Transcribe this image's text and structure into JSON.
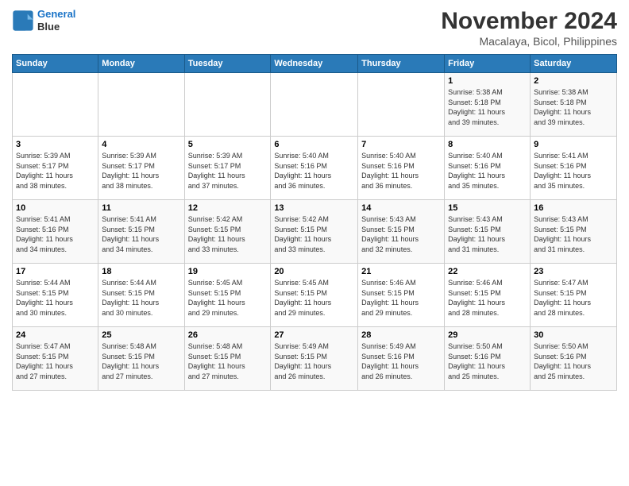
{
  "header": {
    "logo_line1": "General",
    "logo_line2": "Blue",
    "month": "November 2024",
    "location": "Macalaya, Bicol, Philippines"
  },
  "days_of_week": [
    "Sunday",
    "Monday",
    "Tuesday",
    "Wednesday",
    "Thursday",
    "Friday",
    "Saturday"
  ],
  "weeks": [
    {
      "days": [
        {
          "num": "",
          "detail": ""
        },
        {
          "num": "",
          "detail": ""
        },
        {
          "num": "",
          "detail": ""
        },
        {
          "num": "",
          "detail": ""
        },
        {
          "num": "",
          "detail": ""
        },
        {
          "num": "1",
          "detail": "Sunrise: 5:38 AM\nSunset: 5:18 PM\nDaylight: 11 hours\nand 39 minutes."
        },
        {
          "num": "2",
          "detail": "Sunrise: 5:38 AM\nSunset: 5:18 PM\nDaylight: 11 hours\nand 39 minutes."
        }
      ]
    },
    {
      "days": [
        {
          "num": "3",
          "detail": "Sunrise: 5:39 AM\nSunset: 5:17 PM\nDaylight: 11 hours\nand 38 minutes."
        },
        {
          "num": "4",
          "detail": "Sunrise: 5:39 AM\nSunset: 5:17 PM\nDaylight: 11 hours\nand 38 minutes."
        },
        {
          "num": "5",
          "detail": "Sunrise: 5:39 AM\nSunset: 5:17 PM\nDaylight: 11 hours\nand 37 minutes."
        },
        {
          "num": "6",
          "detail": "Sunrise: 5:40 AM\nSunset: 5:16 PM\nDaylight: 11 hours\nand 36 minutes."
        },
        {
          "num": "7",
          "detail": "Sunrise: 5:40 AM\nSunset: 5:16 PM\nDaylight: 11 hours\nand 36 minutes."
        },
        {
          "num": "8",
          "detail": "Sunrise: 5:40 AM\nSunset: 5:16 PM\nDaylight: 11 hours\nand 35 minutes."
        },
        {
          "num": "9",
          "detail": "Sunrise: 5:41 AM\nSunset: 5:16 PM\nDaylight: 11 hours\nand 35 minutes."
        }
      ]
    },
    {
      "days": [
        {
          "num": "10",
          "detail": "Sunrise: 5:41 AM\nSunset: 5:16 PM\nDaylight: 11 hours\nand 34 minutes."
        },
        {
          "num": "11",
          "detail": "Sunrise: 5:41 AM\nSunset: 5:15 PM\nDaylight: 11 hours\nand 34 minutes."
        },
        {
          "num": "12",
          "detail": "Sunrise: 5:42 AM\nSunset: 5:15 PM\nDaylight: 11 hours\nand 33 minutes."
        },
        {
          "num": "13",
          "detail": "Sunrise: 5:42 AM\nSunset: 5:15 PM\nDaylight: 11 hours\nand 33 minutes."
        },
        {
          "num": "14",
          "detail": "Sunrise: 5:43 AM\nSunset: 5:15 PM\nDaylight: 11 hours\nand 32 minutes."
        },
        {
          "num": "15",
          "detail": "Sunrise: 5:43 AM\nSunset: 5:15 PM\nDaylight: 11 hours\nand 31 minutes."
        },
        {
          "num": "16",
          "detail": "Sunrise: 5:43 AM\nSunset: 5:15 PM\nDaylight: 11 hours\nand 31 minutes."
        }
      ]
    },
    {
      "days": [
        {
          "num": "17",
          "detail": "Sunrise: 5:44 AM\nSunset: 5:15 PM\nDaylight: 11 hours\nand 30 minutes."
        },
        {
          "num": "18",
          "detail": "Sunrise: 5:44 AM\nSunset: 5:15 PM\nDaylight: 11 hours\nand 30 minutes."
        },
        {
          "num": "19",
          "detail": "Sunrise: 5:45 AM\nSunset: 5:15 PM\nDaylight: 11 hours\nand 29 minutes."
        },
        {
          "num": "20",
          "detail": "Sunrise: 5:45 AM\nSunset: 5:15 PM\nDaylight: 11 hours\nand 29 minutes."
        },
        {
          "num": "21",
          "detail": "Sunrise: 5:46 AM\nSunset: 5:15 PM\nDaylight: 11 hours\nand 29 minutes."
        },
        {
          "num": "22",
          "detail": "Sunrise: 5:46 AM\nSunset: 5:15 PM\nDaylight: 11 hours\nand 28 minutes."
        },
        {
          "num": "23",
          "detail": "Sunrise: 5:47 AM\nSunset: 5:15 PM\nDaylight: 11 hours\nand 28 minutes."
        }
      ]
    },
    {
      "days": [
        {
          "num": "24",
          "detail": "Sunrise: 5:47 AM\nSunset: 5:15 PM\nDaylight: 11 hours\nand 27 minutes."
        },
        {
          "num": "25",
          "detail": "Sunrise: 5:48 AM\nSunset: 5:15 PM\nDaylight: 11 hours\nand 27 minutes."
        },
        {
          "num": "26",
          "detail": "Sunrise: 5:48 AM\nSunset: 5:15 PM\nDaylight: 11 hours\nand 27 minutes."
        },
        {
          "num": "27",
          "detail": "Sunrise: 5:49 AM\nSunset: 5:15 PM\nDaylight: 11 hours\nand 26 minutes."
        },
        {
          "num": "28",
          "detail": "Sunrise: 5:49 AM\nSunset: 5:16 PM\nDaylight: 11 hours\nand 26 minutes."
        },
        {
          "num": "29",
          "detail": "Sunrise: 5:50 AM\nSunset: 5:16 PM\nDaylight: 11 hours\nand 25 minutes."
        },
        {
          "num": "30",
          "detail": "Sunrise: 5:50 AM\nSunset: 5:16 PM\nDaylight: 11 hours\nand 25 minutes."
        }
      ]
    }
  ]
}
